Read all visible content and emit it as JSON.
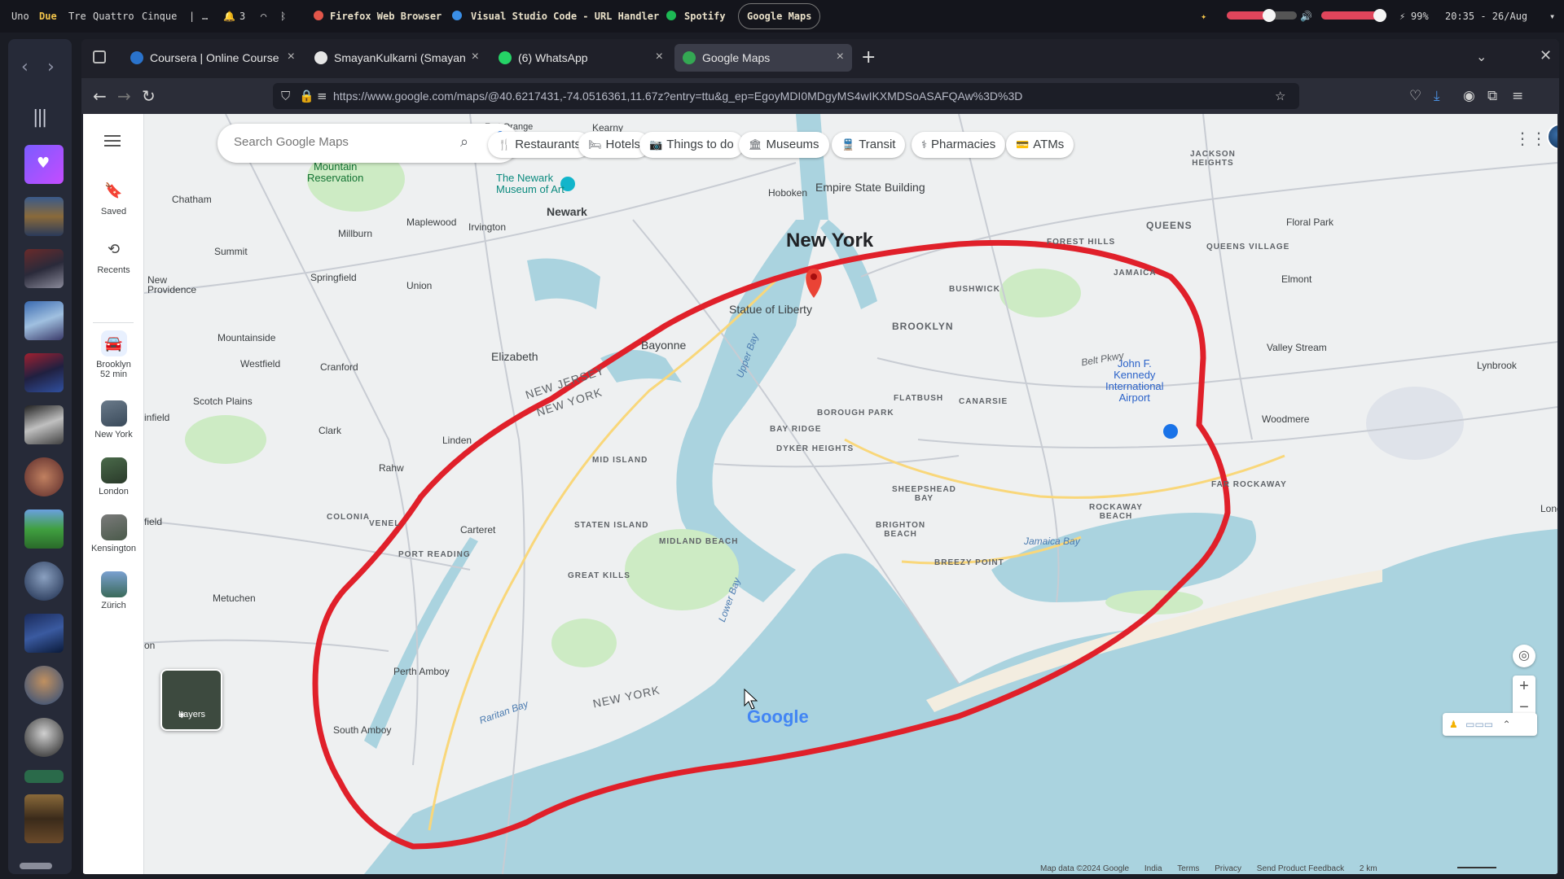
{
  "topbar": {
    "workspaces": [
      "Uno",
      "Due",
      "Tre",
      "Quattro",
      "Cinque"
    ],
    "active_workspace": "Due",
    "separator": "|",
    "ellipsis": "…",
    "notifications": "3",
    "apps": [
      "Firefox Web Browser",
      "Visual Studio Code - URL Handler",
      "Spotify"
    ],
    "active_window": "Google Maps",
    "brightness_level": 0.6,
    "volume_level": 0.9,
    "battery": "99%",
    "clock": "20:35 - 26/Aug"
  },
  "browser": {
    "tabs": [
      {
        "label": "Coursera | Online Course",
        "icon": "coursera-icon"
      },
      {
        "label": "SmayanKulkarni (Smayan",
        "icon": "github-icon"
      },
      {
        "label": "(6) WhatsApp",
        "icon": "whatsapp-icon"
      },
      {
        "label": "Google Maps",
        "icon": "maps-icon",
        "active": true
      }
    ],
    "url": "https://www.google.com/maps/@40.6217431,-74.0516361,11.67z?entry=ttu&g_ep=EgoyMDI0MDgyMS4wIKXMDSoASAFQAw%3D%3D"
  },
  "maps": {
    "search_placeholder": "Search Google Maps",
    "chips": [
      {
        "label": "Restaurants",
        "icon": "fork-knife-icon"
      },
      {
        "label": "Hotels",
        "icon": "bed-icon"
      },
      {
        "label": "Things to do",
        "icon": "camera-icon"
      },
      {
        "label": "Museums",
        "icon": "museum-icon"
      },
      {
        "label": "Transit",
        "icon": "train-icon"
      },
      {
        "label": "Pharmacies",
        "icon": "pharmacy-icon"
      },
      {
        "label": "ATMs",
        "icon": "atm-icon"
      }
    ],
    "rail": {
      "saved": "Saved",
      "recents": "Recents",
      "brooklyn": "Brooklyn",
      "brooklyn_time": "52 min",
      "new_york": "New York",
      "london": "London",
      "kensington": "Kensington",
      "zurich": "Zürich"
    },
    "labels": {
      "new_york": "New York",
      "newark": "Newark",
      "brooklyn": "BROOKLYN",
      "queens": "QUEENS",
      "statue": "Statue of Liberty",
      "empire": "Empire State Building",
      "newark_museum": "The Newark\nMuseum of Art",
      "jfk": "John F.\nKennedy\nInternational\nAirport",
      "bayonne": "Bayonne",
      "elizabeth": "Elizabeth",
      "hoboken": "Hoboken",
      "chatham": "Chatham",
      "maplewood": "Maplewood",
      "irvington": "Irvington",
      "millburn": "Millburn",
      "summit": "Summit",
      "springfield": "Springfield",
      "union": "Union",
      "new_providence": "New\nProvidence",
      "mountainside": "Mountainside",
      "westfield": "Westfield",
      "cranford": "Cranford",
      "scotch_plains": "Scotch Plains",
      "clark": "Clark",
      "linden": "Linden",
      "rahway": "Rahw",
      "carteret": "Carteret",
      "port_reading": "PORT READING",
      "colonia": "COLONIA",
      "avenel": "VENEL",
      "metuchen": "Metuchen",
      "perth_amboy": "Perth Amboy",
      "south_amboy": "South Amboy",
      "edison": "on",
      "plainfield": "infield",
      "field": "field",
      "mid_island": "MID ISLAND",
      "staten_island": "STATEN ISLAND",
      "midland_beach": "MIDLAND BEACH",
      "great_kills": "GREAT KILLS",
      "bay_ridge": "BAY RIDGE",
      "dyker_heights": "DYKER HEIGHTS",
      "borough_park": "BOROUGH PARK",
      "flatbush": "FLATBUSH",
      "canarsie": "CANARSIE",
      "sheepshead_bay": "SHEEPSHEAD\nBAY",
      "brighton_beach": "BRIGHTON\nBEACH",
      "breezy_point": "BREEZY POINT",
      "rockaway_beach": "ROCKAWAY\nBEACH",
      "far_rockaway": "FAR ROCKAWAY",
      "bushwick": "BUSHWICK",
      "jamaica": "JAMAICA",
      "jackson_heights": "JACKSON\nHEIGHTS",
      "forest_hills": "FOREST HILLS",
      "queens_village": "QUEENS VILLAGE",
      "floral_park": "Floral Park",
      "elmont": "Elmont",
      "valley_stream": "Valley Stream",
      "lynbrook": "Lynbrook",
      "woodmere": "Woodmere",
      "long_beach": "Long",
      "jamaica_bay": "Jamaica Bay",
      "upper_bay": "Upper Bay",
      "lower_bay": "Lower Bay",
      "raritan_bay": "Raritan Bay",
      "new_jersey_1": "NEW JERSEY",
      "new_york_state_1": "NEW YORK",
      "new_york_state_2": "NEW YORK",
      "kearny": "Kearny",
      "fort_orange": "Fort Orange",
      "newark_reservation": "South\nMountain\nReservation",
      "belt_pkwy": "Belt Pkwy"
    },
    "layers": "Layers",
    "google": "Google",
    "footer": {
      "map_data": "Map data ©2024 Google",
      "india": "India",
      "terms": "Terms",
      "privacy": "Privacy",
      "feedback": "Send Product Feedback",
      "scale": "2 km"
    }
  }
}
